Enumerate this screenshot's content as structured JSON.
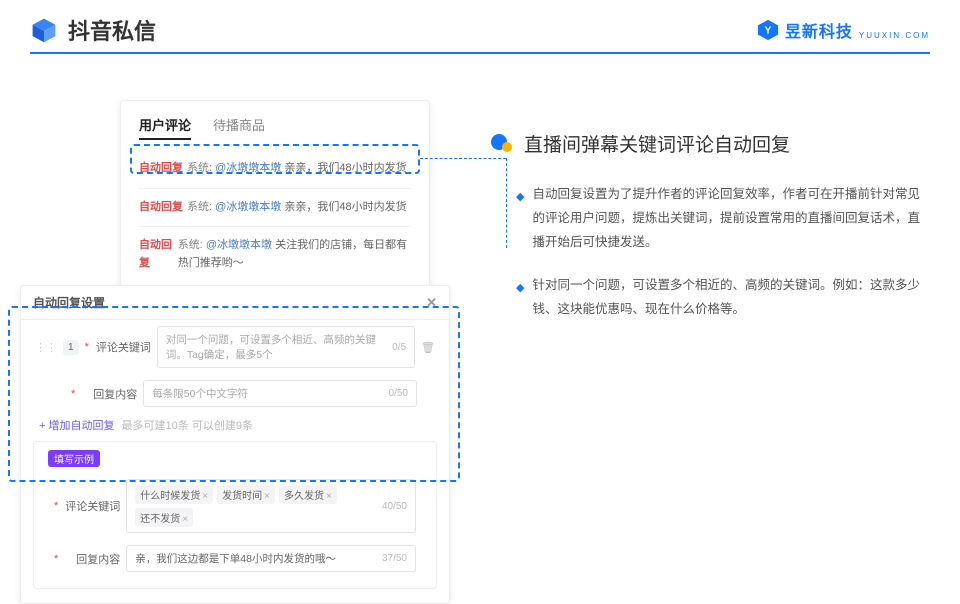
{
  "header": {
    "title": "抖音私信",
    "brand": "昱新科技",
    "brand_sub": "YUUXIN.COM"
  },
  "comments_card": {
    "tab_active": "用户评论",
    "tab_inactive": "待播商品",
    "rows": [
      {
        "tag": "自动回复",
        "sys": "系统:",
        "mention": "@冰墩墩本墩",
        "text": "亲亲，我们48小时内发货"
      },
      {
        "tag": "自动回复",
        "sys": "系统:",
        "mention": "@冰墩墩本墩",
        "text": "亲亲，我们48小时内发货"
      },
      {
        "tag": "自动回复",
        "sys": "系统:",
        "mention": "@冰墩墩本墩",
        "text": "关注我们的店铺，每日都有热门推荐哟～"
      }
    ]
  },
  "settings_card": {
    "title": "自动回复设置",
    "row_index": "1",
    "kw_label": "评论关键词",
    "kw_placeholder": "对同一个问题，可设置多个相近、高频的关键词。Tag确定，最多5个",
    "kw_counter": "0/5",
    "content_label": "回复内容",
    "content_placeholder": "每条限50个中文字符",
    "content_counter": "0/50",
    "add_link": "+ 增加自动回复",
    "add_hint": "最多可建10条 可以创建9条",
    "example_tag": "填写示例",
    "ex_kw_label": "评论关键词",
    "ex_chips": [
      "什么时候发货",
      "发货时间",
      "多久发货",
      "还不发货"
    ],
    "ex_kw_counter": "40/50",
    "ex_content_label": "回复内容",
    "ex_content_value": "亲，我们这边都是下单48小时内发货的哦～",
    "ex_content_counter": "37/50"
  },
  "right": {
    "heading": "直播间弹幕关键词评论自动回复",
    "bullets": [
      "自动回复设置为了提升作者的评论回复效率，作者可在开播前针对常见的评论用户问题，提炼出关键词，提前设置常用的直播间回复话术，直播开始后可快捷发送。",
      "针对同一个问题，可设置多个相近的、高频的关键词。例如：这款多少钱、这块能优惠吗、现在什么价格等。"
    ]
  }
}
